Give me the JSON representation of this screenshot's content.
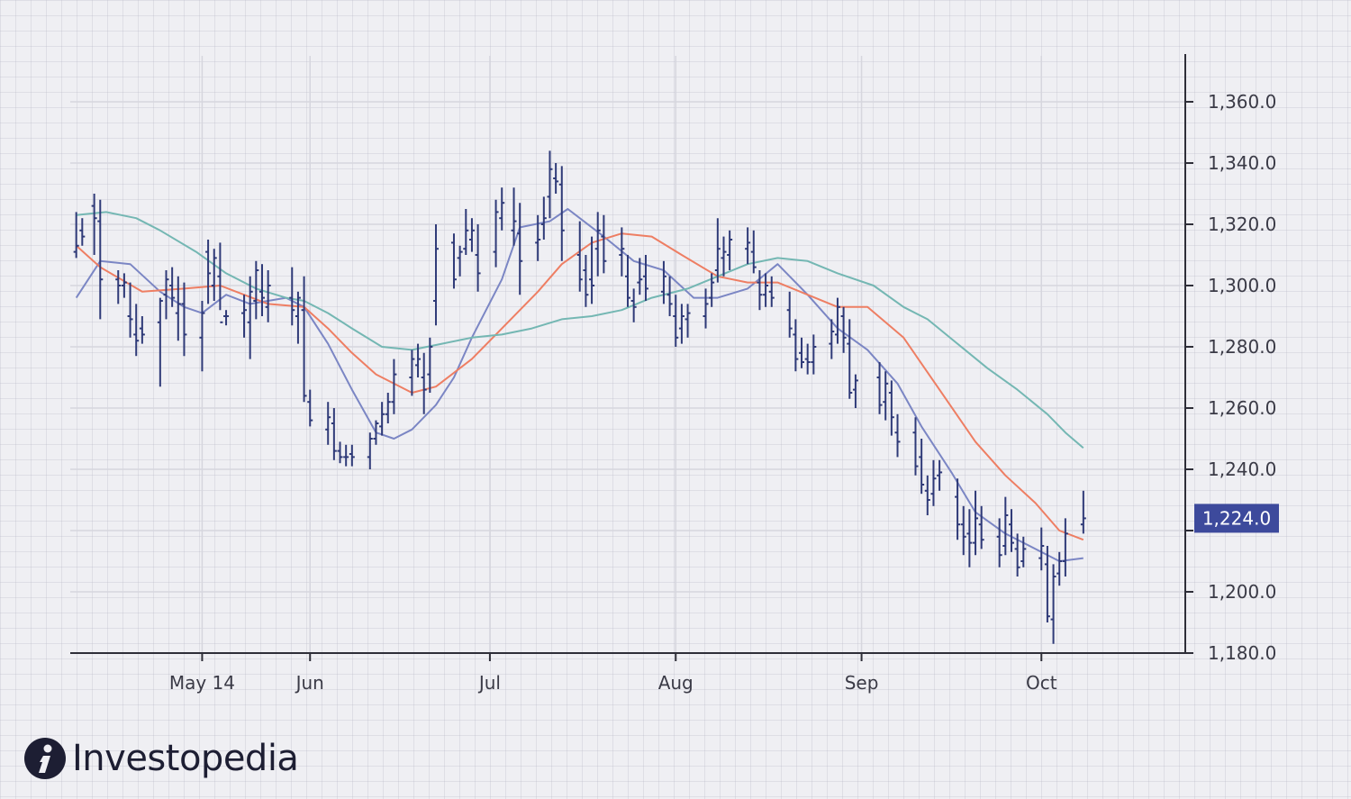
{
  "colors": {
    "price_bars": "#2f3a78",
    "ma_fast": "#7b86c4",
    "ma_medium": "#ee7e63",
    "ma_slow": "#74b7b3",
    "gridline": "#d6d6de",
    "axis": "#2e2e38",
    "price_tag_bg": "#3d4a9c"
  },
  "brand": {
    "name": "Investopedia",
    "icon": "investopedia-logo-icon"
  },
  "chart_data": {
    "type": "ohlc",
    "title": "",
    "xlabel": "",
    "ylabel": "",
    "ylim": [
      1180,
      1375
    ],
    "yticks": [
      1180,
      1200,
      1220,
      1240,
      1260,
      1280,
      1300,
      1320,
      1340,
      1360
    ],
    "ytick_labels": [
      "1,180.0",
      "1,200.0",
      "",
      "1,240.0",
      "1,260.0",
      "1,280.0",
      "1,300.0",
      "1,320.0",
      "1,340.0",
      "1,360.0"
    ],
    "xlim": [
      "2018-04-22",
      "2018-10-25"
    ],
    "xticks": [
      "2018-05-14",
      "2018-06-01",
      "2018-07-01",
      "2018-08-01",
      "2018-09-01",
      "2018-10-01"
    ],
    "xtick_labels": [
      "May 14",
      "Jun",
      "Jul",
      "Aug",
      "Sep",
      "Oct"
    ],
    "grid": true,
    "last_price": 1224.0,
    "last_price_label": "1,224.0",
    "bars": [
      [
        "2018-04-23",
        1324,
        1309,
        1311,
        1313
      ],
      [
        "2018-04-24",
        1322,
        1313,
        1318,
        1316
      ],
      [
        "2018-04-26",
        1330,
        1310,
        1326,
        1322
      ],
      [
        "2018-04-27",
        1328,
        1289,
        1321,
        1302
      ],
      [
        "2018-04-30",
        1305,
        1294,
        1302,
        1300
      ],
      [
        "2018-05-01",
        1304,
        1296,
        1300,
        1301
      ],
      [
        "2018-05-02",
        1301,
        1283,
        1290,
        1289
      ],
      [
        "2018-05-03",
        1294,
        1277,
        1284,
        1282
      ],
      [
        "2018-05-04",
        1290,
        1281,
        1286,
        1284
      ],
      [
        "2018-05-07",
        1296,
        1267,
        1288,
        1295
      ],
      [
        "2018-05-08",
        1305,
        1289,
        1297,
        1302
      ],
      [
        "2018-05-09",
        1306,
        1293,
        1300,
        1296
      ],
      [
        "2018-05-10",
        1303,
        1282,
        1291,
        1294
      ],
      [
        "2018-05-11",
        1301,
        1277,
        1294,
        1284
      ],
      [
        "2018-05-14",
        1295,
        1272,
        1283,
        1291
      ],
      [
        "2018-05-15",
        1315,
        1294,
        1311,
        1304
      ],
      [
        "2018-05-16",
        1312,
        1295,
        1300,
        1309
      ],
      [
        "2018-05-17",
        1314,
        1292,
        1303,
        1288
      ],
      [
        "2018-05-18",
        1292,
        1287,
        1290,
        1290
      ],
      [
        "2018-05-21",
        1297,
        1283,
        1291,
        1292
      ],
      [
        "2018-05-22",
        1303,
        1276,
        1288,
        1298
      ],
      [
        "2018-05-23",
        1308,
        1289,
        1295,
        1305
      ],
      [
        "2018-05-24",
        1307,
        1290,
        1298,
        1296
      ],
      [
        "2018-05-25",
        1305,
        1288,
        1293,
        1300
      ],
      [
        "2018-05-29",
        1306,
        1287,
        1296,
        1292
      ],
      [
        "2018-05-30",
        1298,
        1281,
        1290,
        1296
      ],
      [
        "2018-05-31",
        1303,
        1262,
        1292,
        1264
      ],
      [
        "2018-06-01",
        1266,
        1254,
        1262,
        1256
      ],
      [
        "2018-06-04",
        1262,
        1248,
        1253,
        1257
      ],
      [
        "2018-06-05",
        1260,
        1243,
        1255,
        1246
      ],
      [
        "2018-06-06",
        1249,
        1242,
        1246,
        1244
      ],
      [
        "2018-06-07",
        1248,
        1241,
        1244,
        1244
      ],
      [
        "2018-06-08",
        1248,
        1241,
        1245,
        1244
      ],
      [
        "2018-06-11",
        1252,
        1240,
        1244,
        1250
      ],
      [
        "2018-06-12",
        1256,
        1248,
        1250,
        1255
      ],
      [
        "2018-06-13",
        1262,
        1251,
        1254,
        1258
      ],
      [
        "2018-06-14",
        1265,
        1255,
        1258,
        1262
      ],
      [
        "2018-06-15",
        1276,
        1258,
        1262,
        1271
      ],
      [
        "2018-06-18",
        1279,
        1264,
        1270,
        1276
      ],
      [
        "2018-06-19",
        1281,
        1270,
        1274,
        1276
      ],
      [
        "2018-06-20",
        1278,
        1258,
        1270,
        1266
      ],
      [
        "2018-06-21",
        1283,
        1265,
        1271,
        1280
      ],
      [
        "2018-06-22",
        1320,
        1287,
        1295,
        1312
      ],
      [
        "2018-06-25",
        1317,
        1299,
        1314,
        1302
      ],
      [
        "2018-06-26",
        1313,
        1303,
        1309,
        1311
      ],
      [
        "2018-06-27",
        1325,
        1310,
        1312,
        1318
      ],
      [
        "2018-06-28",
        1322,
        1311,
        1315,
        1318
      ],
      [
        "2018-06-29",
        1320,
        1298,
        1310,
        1304
      ],
      [
        "2018-07-02",
        1328,
        1306,
        1311,
        1324
      ],
      [
        "2018-07-03",
        1332,
        1318,
        1322,
        1327
      ],
      [
        "2018-07-05",
        1332,
        1313,
        1318,
        1321
      ],
      [
        "2018-07-06",
        1327,
        1297,
        1317,
        1308
      ],
      [
        "2018-07-09",
        1323,
        1308,
        1314,
        1315
      ],
      [
        "2018-07-10",
        1329,
        1315,
        1320,
        1322
      ],
      [
        "2018-07-11",
        1344,
        1322,
        1329,
        1338
      ],
      [
        "2018-07-12",
        1340,
        1330,
        1335,
        1334
      ],
      [
        "2018-07-13",
        1339,
        1308,
        1333,
        1318
      ],
      [
        "2018-07-16",
        1321,
        1298,
        1310,
        1302
      ],
      [
        "2018-07-17",
        1310,
        1293,
        1305,
        1297
      ],
      [
        "2018-07-18",
        1316,
        1294,
        1302,
        1300
      ],
      [
        "2018-07-19",
        1324,
        1303,
        1312,
        1318
      ],
      [
        "2018-07-20",
        1323,
        1304,
        1316,
        1308
      ],
      [
        "2018-07-23",
        1319,
        1303,
        1310,
        1312
      ],
      [
        "2018-07-24",
        1310,
        1293,
        1303,
        1296
      ],
      [
        "2018-07-25",
        1299,
        1288,
        1295,
        1293
      ],
      [
        "2018-07-26",
        1309,
        1297,
        1301,
        1302
      ],
      [
        "2018-07-27",
        1310,
        1295,
        1303,
        1299
      ],
      [
        "2018-07-30",
        1308,
        1294,
        1298,
        1303
      ],
      [
        "2018-07-31",
        1303,
        1290,
        1297,
        1294
      ],
      [
        "2018-08-01",
        1297,
        1280,
        1290,
        1283
      ],
      [
        "2018-08-02",
        1294,
        1281,
        1286,
        1290
      ],
      [
        "2018-08-03",
        1294,
        1283,
        1289,
        1291
      ],
      [
        "2018-08-06",
        1299,
        1286,
        1290,
        1294
      ],
      [
        "2018-08-07",
        1304,
        1293,
        1296,
        1301
      ],
      [
        "2018-08-08",
        1322,
        1301,
        1305,
        1312
      ],
      [
        "2018-08-09",
        1316,
        1303,
        1309,
        1311
      ],
      [
        "2018-08-10",
        1318,
        1305,
        1310,
        1315
      ],
      [
        "2018-08-13",
        1319,
        1307,
        1312,
        1314
      ],
      [
        "2018-08-14",
        1318,
        1304,
        1311,
        1306
      ],
      [
        "2018-08-15",
        1305,
        1292,
        1301,
        1297
      ],
      [
        "2018-08-16",
        1304,
        1293,
        1297,
        1300
      ],
      [
        "2018-08-17",
        1303,
        1293,
        1298,
        1296
      ],
      [
        "2018-08-20",
        1298,
        1283,
        1292,
        1286
      ],
      [
        "2018-08-21",
        1289,
        1272,
        1284,
        1276
      ],
      [
        "2018-08-22",
        1283,
        1273,
        1278,
        1275
      ],
      [
        "2018-08-23",
        1281,
        1271,
        1276,
        1275
      ],
      [
        "2018-08-24",
        1284,
        1271,
        1275,
        1280
      ],
      [
        "2018-08-27",
        1289,
        1276,
        1281,
        1285
      ],
      [
        "2018-08-28",
        1296,
        1281,
        1284,
        1293
      ],
      [
        "2018-08-29",
        1293,
        1278,
        1290,
        1283
      ],
      [
        "2018-08-30",
        1289,
        1263,
        1281,
        1265
      ],
      [
        "2018-08-31",
        1271,
        1260,
        1266,
        1269
      ],
      [
        "2018-09-04",
        1275,
        1258,
        1270,
        1261
      ],
      [
        "2018-09-05",
        1272,
        1256,
        1262,
        1268
      ],
      [
        "2018-09-06",
        1269,
        1251,
        1265,
        1257
      ],
      [
        "2018-09-07",
        1258,
        1244,
        1252,
        1249
      ],
      [
        "2018-09-10",
        1257,
        1238,
        1252,
        1241
      ],
      [
        "2018-09-11",
        1250,
        1232,
        1244,
        1235
      ],
      [
        "2018-09-12",
        1238,
        1225,
        1233,
        1230
      ],
      [
        "2018-09-13",
        1243,
        1228,
        1232,
        1237
      ],
      [
        "2018-09-14",
        1243,
        1233,
        1238,
        1239
      ],
      [
        "2018-09-17",
        1237,
        1217,
        1231,
        1222
      ],
      [
        "2018-09-18",
        1228,
        1212,
        1222,
        1218
      ],
      [
        "2018-09-19",
        1227,
        1208,
        1219,
        1216
      ],
      [
        "2018-09-20",
        1233,
        1212,
        1216,
        1224
      ],
      [
        "2018-09-21",
        1228,
        1214,
        1222,
        1217
      ],
      [
        "2018-09-24",
        1224,
        1208,
        1218,
        1212
      ],
      [
        "2018-09-25",
        1231,
        1212,
        1215,
        1225
      ],
      [
        "2018-09-26",
        1227,
        1213,
        1222,
        1216
      ],
      [
        "2018-09-27",
        1219,
        1205,
        1214,
        1208
      ],
      [
        "2018-09-28",
        1218,
        1208,
        1210,
        1214
      ],
      [
        "2018-10-01",
        1221,
        1207,
        1211,
        1215
      ],
      [
        "2018-10-02",
        1215,
        1190,
        1209,
        1192
      ],
      [
        "2018-10-03",
        1209,
        1183,
        1191,
        1205
      ],
      [
        "2018-10-04",
        1213,
        1202,
        1206,
        1210
      ],
      [
        "2018-10-05",
        1224,
        1205,
        1210,
        1219
      ],
      [
        "2018-10-08",
        1233,
        1219,
        1222,
        1224
      ]
    ],
    "series": [
      {
        "type": "line",
        "color": "#7b86c4",
        "points": [
          [
            "2018-04-23",
            1296
          ],
          [
            "2018-04-27",
            1308
          ],
          [
            "2018-05-02",
            1307
          ],
          [
            "2018-05-07",
            1298
          ],
          [
            "2018-05-11",
            1293
          ],
          [
            "2018-05-14",
            1291
          ],
          [
            "2018-05-18",
            1297
          ],
          [
            "2018-05-22",
            1294
          ],
          [
            "2018-05-28",
            1296
          ],
          [
            "2018-05-31",
            1293
          ],
          [
            "2018-06-04",
            1281
          ],
          [
            "2018-06-08",
            1266
          ],
          [
            "2018-06-12",
            1252
          ],
          [
            "2018-06-15",
            1250
          ],
          [
            "2018-06-18",
            1253
          ],
          [
            "2018-06-22",
            1261
          ],
          [
            "2018-06-25",
            1270
          ],
          [
            "2018-06-28",
            1283
          ],
          [
            "2018-07-03",
            1302
          ],
          [
            "2018-07-06",
            1319
          ],
          [
            "2018-07-11",
            1321
          ],
          [
            "2018-07-14",
            1325
          ],
          [
            "2018-07-20",
            1316
          ],
          [
            "2018-07-25",
            1308
          ],
          [
            "2018-07-30",
            1305
          ],
          [
            "2018-08-04",
            1296
          ],
          [
            "2018-08-08",
            1296
          ],
          [
            "2018-08-13",
            1299
          ],
          [
            "2018-08-18",
            1307
          ],
          [
            "2018-08-23",
            1297
          ],
          [
            "2018-08-28",
            1286
          ],
          [
            "2018-09-02",
            1279
          ],
          [
            "2018-09-07",
            1268
          ],
          [
            "2018-09-11",
            1254
          ],
          [
            "2018-09-16",
            1239
          ],
          [
            "2018-09-20",
            1226
          ],
          [
            "2018-09-25",
            1219
          ],
          [
            "2018-09-30",
            1214
          ],
          [
            "2018-10-04",
            1210
          ],
          [
            "2018-10-08",
            1211
          ]
        ]
      },
      {
        "type": "line",
        "color": "#ee7e63",
        "points": [
          [
            "2018-04-23",
            1313
          ],
          [
            "2018-04-27",
            1306
          ],
          [
            "2018-05-04",
            1298
          ],
          [
            "2018-05-11",
            1299
          ],
          [
            "2018-05-17",
            1300
          ],
          [
            "2018-05-21",
            1297
          ],
          [
            "2018-05-25",
            1294
          ],
          [
            "2018-05-31",
            1293
          ],
          [
            "2018-06-04",
            1286
          ],
          [
            "2018-06-08",
            1278
          ],
          [
            "2018-06-12",
            1271
          ],
          [
            "2018-06-18",
            1265
          ],
          [
            "2018-06-22",
            1267
          ],
          [
            "2018-06-28",
            1276
          ],
          [
            "2018-07-04",
            1288
          ],
          [
            "2018-07-09",
            1298
          ],
          [
            "2018-07-13",
            1307
          ],
          [
            "2018-07-18",
            1314
          ],
          [
            "2018-07-23",
            1317
          ],
          [
            "2018-07-28",
            1316
          ],
          [
            "2018-08-02",
            1310
          ],
          [
            "2018-08-08",
            1303
          ],
          [
            "2018-08-13",
            1301
          ],
          [
            "2018-08-18",
            1301
          ],
          [
            "2018-08-23",
            1297
          ],
          [
            "2018-08-28",
            1293
          ],
          [
            "2018-09-02",
            1293
          ],
          [
            "2018-09-08",
            1283
          ],
          [
            "2018-09-14",
            1266
          ],
          [
            "2018-09-20",
            1249
          ],
          [
            "2018-09-25",
            1238
          ],
          [
            "2018-09-30",
            1229
          ],
          [
            "2018-10-04",
            1220
          ],
          [
            "2018-10-08",
            1217
          ]
        ]
      },
      {
        "type": "line",
        "color": "#74b7b3",
        "points": [
          [
            "2018-04-23",
            1323
          ],
          [
            "2018-04-28",
            1324
          ],
          [
            "2018-05-03",
            1322
          ],
          [
            "2018-05-07",
            1318
          ],
          [
            "2018-05-13",
            1311
          ],
          [
            "2018-05-18",
            1304
          ],
          [
            "2018-05-23",
            1299
          ],
          [
            "2018-05-28",
            1296
          ],
          [
            "2018-05-31",
            1295
          ],
          [
            "2018-06-04",
            1291
          ],
          [
            "2018-06-08",
            1286
          ],
          [
            "2018-06-13",
            1280
          ],
          [
            "2018-06-18",
            1279
          ],
          [
            "2018-06-23",
            1281
          ],
          [
            "2018-06-28",
            1283
          ],
          [
            "2018-07-03",
            1284
          ],
          [
            "2018-07-08",
            1286
          ],
          [
            "2018-07-13",
            1289
          ],
          [
            "2018-07-18",
            1290
          ],
          [
            "2018-07-23",
            1292
          ],
          [
            "2018-07-28",
            1296
          ],
          [
            "2018-08-03",
            1299
          ],
          [
            "2018-08-08",
            1303
          ],
          [
            "2018-08-13",
            1307
          ],
          [
            "2018-08-18",
            1309
          ],
          [
            "2018-08-23",
            1308
          ],
          [
            "2018-08-28",
            1304
          ],
          [
            "2018-09-03",
            1300
          ],
          [
            "2018-09-08",
            1293
          ],
          [
            "2018-09-12",
            1289
          ],
          [
            "2018-09-17",
            1281
          ],
          [
            "2018-09-22",
            1273
          ],
          [
            "2018-09-27",
            1266
          ],
          [
            "2018-10-02",
            1258
          ],
          [
            "2018-10-05",
            1252
          ],
          [
            "2018-10-08",
            1247
          ]
        ]
      }
    ]
  }
}
